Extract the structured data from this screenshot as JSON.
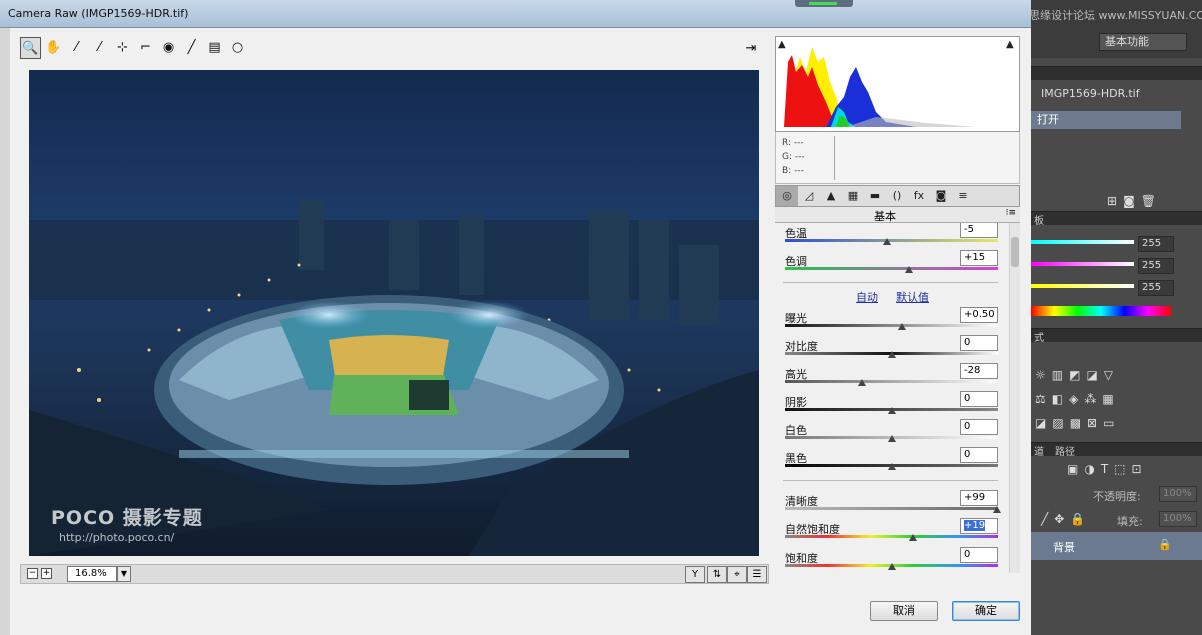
{
  "window": {
    "title": "Camera Raw (IMGP1569-HDR.tif)"
  },
  "toolbar": {
    "tools": [
      {
        "icon": "zoom-icon",
        "glyph": "🔍"
      },
      {
        "icon": "hand-icon",
        "glyph": "✋"
      },
      {
        "icon": "white-balance-icon",
        "glyph": "⁄"
      },
      {
        "icon": "color-sampler-icon",
        "glyph": "⁄"
      },
      {
        "icon": "target-adjust-icon",
        "glyph": "⊹"
      },
      {
        "icon": "crop-icon",
        "glyph": "⌐"
      },
      {
        "icon": "redeye-icon",
        "glyph": "◉"
      },
      {
        "icon": "brush-icon",
        "glyph": "╱"
      },
      {
        "icon": "graduated-filter-icon",
        "glyph": "▤"
      },
      {
        "icon": "radial-filter-icon",
        "glyph": "○"
      }
    ],
    "fullscreen_icon": "⇥"
  },
  "preview": {
    "watermark_title": "POCO 摄影专题",
    "watermark_url": "http://photo.poco.cn/"
  },
  "bottom_bar": {
    "zoom": "16.8%",
    "zoom_out": "−",
    "zoom_in": "+",
    "dropdown": "▼",
    "btn1": "Y",
    "btn2": "⇅",
    "btn3": "⌖",
    "btn4": "☰"
  },
  "histogram": {
    "clip_shadow": "▲",
    "clip_highlight": "▲"
  },
  "readout": {
    "r": "R:  ---",
    "g": "G:  ---",
    "b": "B:  ---"
  },
  "panel": {
    "tabs": [
      {
        "icon": "basic-tab-icon",
        "glyph": "◎"
      },
      {
        "icon": "tone-curve-tab-icon",
        "glyph": "◿"
      },
      {
        "icon": "detail-tab-icon",
        "glyph": "▲"
      },
      {
        "icon": "hsl-tab-icon",
        "glyph": "▦"
      },
      {
        "icon": "split-toning-tab-icon",
        "glyph": "▬"
      },
      {
        "icon": "lens-tab-icon",
        "glyph": "()"
      },
      {
        "icon": "fx-tab-icon",
        "glyph": "fx"
      },
      {
        "icon": "camera-calibration-tab-icon",
        "glyph": "◙"
      },
      {
        "icon": "presets-tab-icon",
        "glyph": "≡"
      }
    ],
    "title": "基本",
    "menu": "⁝≡",
    "auto": "自动",
    "default": "默认值"
  },
  "sliders": {
    "temperature": {
      "label": "色温",
      "value": "-5",
      "level": 0.48
    },
    "tint": {
      "label": "色调",
      "value": "+15",
      "level": 0.58
    },
    "exposure": {
      "label": "曝光",
      "value": "+0.50",
      "level": 0.55
    },
    "contrast": {
      "label": "对比度",
      "value": "0",
      "level": 0.5
    },
    "highlights": {
      "label": "高光",
      "value": "-28",
      "level": 0.36
    },
    "shadows": {
      "label": "阴影",
      "value": "0",
      "level": 0.5
    },
    "whites": {
      "label": "白色",
      "value": "0",
      "level": 0.5
    },
    "blacks": {
      "label": "黑色",
      "value": "0",
      "level": 0.5
    },
    "clarity": {
      "label": "清晰度",
      "value": "+99",
      "level": 0.995
    },
    "vibrance": {
      "label": "自然饱和度",
      "value": "+19",
      "level": 0.6
    },
    "saturation": {
      "label": "饱和度",
      "value": "0",
      "level": 0.5
    }
  },
  "buttons": {
    "cancel": "取消",
    "ok": "确定"
  },
  "photoshop": {
    "watermark": "思缘设计论坛 www.MISSYUAN.COM",
    "workspace": "基本功能",
    "history_file": "IMGP1569-HDR.tif",
    "history_open": "打开",
    "panel_swatch_label": "板",
    "color_values": [
      "255",
      "255",
      "255"
    ],
    "styles_label": "式",
    "channels_tab": "道",
    "paths_tab": "路径",
    "opacity_label": "不透明度:",
    "opacity_value": "100%",
    "fill_label": "填充:",
    "fill_value": "100%",
    "layer_name": "背景",
    "lock_icon": "🔒"
  },
  "colors": {
    "accent": "#3b84d8",
    "layer_selected": "#6b7a91"
  }
}
